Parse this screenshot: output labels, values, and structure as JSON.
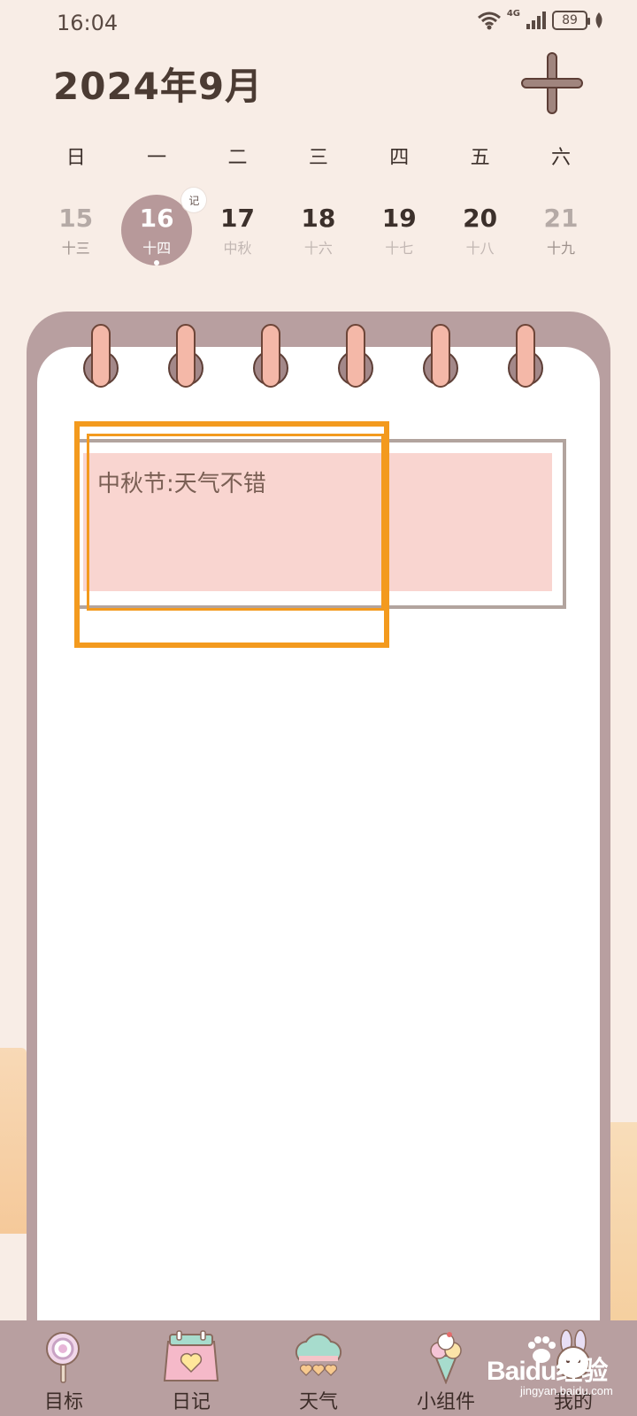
{
  "status_bar": {
    "time": "16:04",
    "network": "4G",
    "battery": "89"
  },
  "header": {
    "title": "2024年9月",
    "add_icon": "plus-icon"
  },
  "weekdays": [
    "日",
    "一",
    "二",
    "三",
    "四",
    "五",
    "六"
  ],
  "dates": [
    {
      "day": "15",
      "lunar": "十三"
    },
    {
      "day": "16",
      "lunar": "十四",
      "badge": "记"
    },
    {
      "day": "17",
      "lunar": "中秋"
    },
    {
      "day": "18",
      "lunar": "十六"
    },
    {
      "day": "19",
      "lunar": "十七"
    },
    {
      "day": "20",
      "lunar": "十八"
    },
    {
      "day": "21",
      "lunar": "十九"
    }
  ],
  "selected_date": "16",
  "entry": {
    "text": "中秋节:天气不错"
  },
  "colors": {
    "background": "#f8ede6",
    "frame": "#b89fa0",
    "entry_fill": "#f9d5d0",
    "highlight": "#f39a1e",
    "ring": "#f4b8a8"
  },
  "nav": {
    "items": [
      {
        "label": "目标",
        "icon": "lollipop-icon"
      },
      {
        "label": "日记",
        "icon": "calendar-heart-icon"
      },
      {
        "label": "天气",
        "icon": "cloud-hearts-icon"
      },
      {
        "label": "小组件",
        "icon": "ice-cream-icon"
      },
      {
        "label": "我的",
        "icon": "bunny-icon"
      }
    ]
  },
  "watermark": {
    "text": "Baidu经验",
    "url": "jingyan.baidu.com"
  }
}
